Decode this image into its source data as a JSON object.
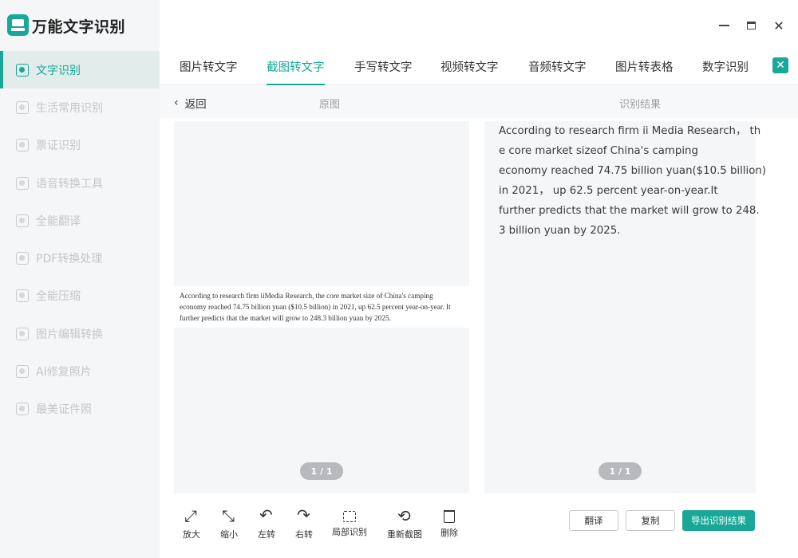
{
  "app": {
    "title": "万能文字识别"
  },
  "sidebar": {
    "items": [
      {
        "label": "文字识别",
        "active": true,
        "icon": "text-recognition-icon"
      },
      {
        "label": "生活常用识别",
        "icon": "daily-recognition-icon"
      },
      {
        "label": "票证识别",
        "icon": "ticket-icon"
      },
      {
        "label": "语音转换工具",
        "icon": "voice-icon"
      },
      {
        "label": "全能翻译",
        "icon": "translate-icon"
      },
      {
        "label": "PDF转换处理",
        "icon": "pdf-icon"
      },
      {
        "label": "全能压缩",
        "icon": "compress-icon"
      },
      {
        "label": "图片编辑转换",
        "icon": "image-edit-icon"
      },
      {
        "label": "AI修复照片",
        "icon": "ai-photo-icon"
      },
      {
        "label": "最美证件照",
        "icon": "id-photo-icon"
      }
    ]
  },
  "tabs": [
    {
      "label": "图片转文字"
    },
    {
      "label": "截图转文字",
      "active": true
    },
    {
      "label": "手写转文字"
    },
    {
      "label": "视频转文字"
    },
    {
      "label": "音频转文字"
    },
    {
      "label": "图片转表格"
    },
    {
      "label": "数字识别"
    }
  ],
  "subheader": {
    "back": "返回",
    "left_title": "原图",
    "right_title": "识别结果"
  },
  "source_image": {
    "lines": [
      "According to research firm iiMedia Research, the core market size of China's camping",
      "economy reached 74.75 billion yuan ($10.5 billion) in 2021, up 62.5 percent year-on-year. It",
      "further predicts that the market will grow to 248.3 billion yuan by 2025."
    ]
  },
  "result": {
    "lines": [
      "According to research firm ii Media Research， th",
      "e core market sizeof China's camping",
      "economy reached 74.75 billion yuan($10.5 billion)",
      "in 2021， up 62.5 percent year-on-year.It",
      "further predicts that the market will grow to 248.",
      "3 billion yuan by 2025."
    ]
  },
  "pager": {
    "left": "1 / 1",
    "right": "1 / 1"
  },
  "toolbar": [
    {
      "label": "放大",
      "icon": "zoom-in-icon"
    },
    {
      "label": "缩小",
      "icon": "zoom-out-icon"
    },
    {
      "label": "左转",
      "icon": "rotate-left-icon"
    },
    {
      "label": "右转",
      "icon": "rotate-right-icon"
    },
    {
      "label": "局部识别",
      "icon": "partial-recognition-icon"
    },
    {
      "label": "重新截图",
      "icon": "rescreenshot-icon"
    },
    {
      "label": "删除",
      "icon": "delete-icon"
    }
  ],
  "actions": {
    "translate": "翻译",
    "copy": "复制",
    "export": "导出识别结果"
  },
  "colors": {
    "accent": "#19a797"
  }
}
